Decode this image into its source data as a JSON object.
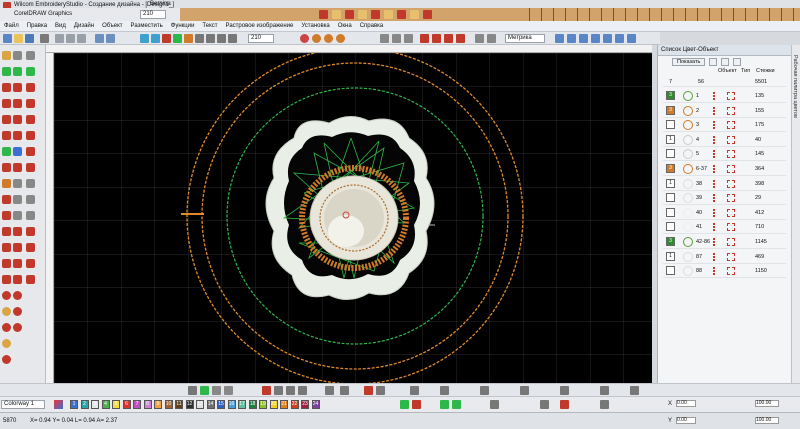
{
  "window": {
    "title": "Wilcom EmbroideryStudio - Создание дизайна - [Design1_]",
    "tab": "Bernina"
  },
  "strip": {
    "app_label": "CorelDRAW Graphics",
    "size_field": "210"
  },
  "menu": [
    "Файл",
    "Правка",
    "Вид",
    "Дизайн",
    "Объект",
    "Разместить",
    "Функции",
    "Текст",
    "Растровое изображение",
    "Установка",
    "Окна",
    "Справка"
  ],
  "toolbar": {
    "zoom_value": "210",
    "units_value": "Метрика"
  },
  "panel": {
    "title": "Список Цвет-Объект",
    "show_button": "Показать",
    "col_object": "Объект",
    "col_type": "Тип",
    "col_stitches": "Стежки",
    "vertical_tab": "Рабочая палитра цветов",
    "total_label": "7",
    "total_sub": "56",
    "total_stitches": "5501",
    "rows": [
      {
        "badge": "3",
        "badge_color": "#2e8b2e",
        "num": "1",
        "stitches": "135",
        "thumb": "#5c9e3a"
      },
      {
        "badge": "3",
        "badge_color": "#d07a2a",
        "num": "2",
        "stitches": "155",
        "thumb": "#d07a2a"
      },
      {
        "badge": "",
        "badge_color": "#ffffff",
        "num": "3",
        "stitches": "175",
        "thumb": "#d07a2a"
      },
      {
        "badge": "1",
        "badge_color": "#ffffff",
        "num": "4",
        "stitches": "40",
        "thumb": "#cccccc"
      },
      {
        "badge": "",
        "badge_color": "#ffffff",
        "num": "5",
        "stitches": "145",
        "thumb": "#cccccc"
      },
      {
        "badge": "3",
        "badge_color": "#d07a2a",
        "num": "6-37",
        "stitches": "364",
        "thumb": "#d07a2a"
      },
      {
        "badge": "1",
        "badge_color": "#ffffff",
        "num": "38",
        "stitches": "398",
        "thumb": "#dddddd"
      },
      {
        "badge": "",
        "badge_color": "#ffffff",
        "num": "39",
        "stitches": "29",
        "thumb": "#dddddd"
      },
      {
        "badge": "",
        "badge_color": "#ffffff",
        "num": "40",
        "stitches": "412",
        "thumb": "#eeeeee"
      },
      {
        "badge": "",
        "badge_color": "#ffffff",
        "num": "41",
        "stitches": "710",
        "thumb": "#eeeeee"
      },
      {
        "badge": "3",
        "badge_color": "#2e8b2e",
        "num": "42-86",
        "stitches": "1145",
        "thumb": "#5c9e3a"
      },
      {
        "badge": "1",
        "badge_color": "#ffffff",
        "num": "87",
        "stitches": "469",
        "thumb": "#dddddd"
      },
      {
        "badge": "",
        "badge_color": "#ffffff",
        "num": "88",
        "stitches": "1150",
        "thumb": "#dddddd"
      }
    ]
  },
  "palette": {
    "selector": "Colorway 1",
    "swatches": [
      {
        "label": "1",
        "color": "#3b6fd1"
      },
      {
        "label": "2",
        "color": "#2aa6a6"
      },
      {
        "label": "3",
        "color": "#e8e8e8"
      },
      {
        "label": "4",
        "color": "#4caf50"
      },
      {
        "label": "5",
        "color": "#f0e040"
      },
      {
        "label": "6",
        "color": "#e03030"
      },
      {
        "label": "7",
        "color": "#c050c0"
      },
      {
        "label": "8",
        "color": "#d080d0"
      },
      {
        "label": "9",
        "color": "#f0a040"
      },
      {
        "label": "10",
        "color": "#a06030"
      },
      {
        "label": "11",
        "color": "#604020"
      },
      {
        "label": "12",
        "color": "#303030"
      },
      {
        "label": "13",
        "color": "#e0e0e0"
      },
      {
        "label": "14",
        "color": "#707070"
      },
      {
        "label": "15",
        "color": "#3060c0"
      },
      {
        "label": "16",
        "color": "#40a0e0"
      },
      {
        "label": "17",
        "color": "#60c0a0"
      },
      {
        "label": "18",
        "color": "#208040"
      },
      {
        "label": "19",
        "color": "#90c030"
      },
      {
        "label": "20",
        "color": "#f0d020"
      },
      {
        "label": "21",
        "color": "#e08020"
      },
      {
        "label": "22",
        "color": "#d04020"
      },
      {
        "label": "23",
        "color": "#a02040"
      },
      {
        "label": "24",
        "color": "#8040a0"
      }
    ]
  },
  "status": {
    "stitch_count": "5870",
    "coords": "X= 0.94 Y= 0.04 L= 0.94 A= 2.37",
    "x_label": "X",
    "y_label": "Y",
    "x_value": "0.00",
    "y_value": "0.00",
    "w_value": "100.00",
    "h_value": "100.00"
  },
  "colors": {
    "canvas_bg": "#000000",
    "ring_orange": "#e08a2a",
    "ring_green": "#2fb84a",
    "satin_white": "#e9eee6",
    "grid": "#444444"
  }
}
